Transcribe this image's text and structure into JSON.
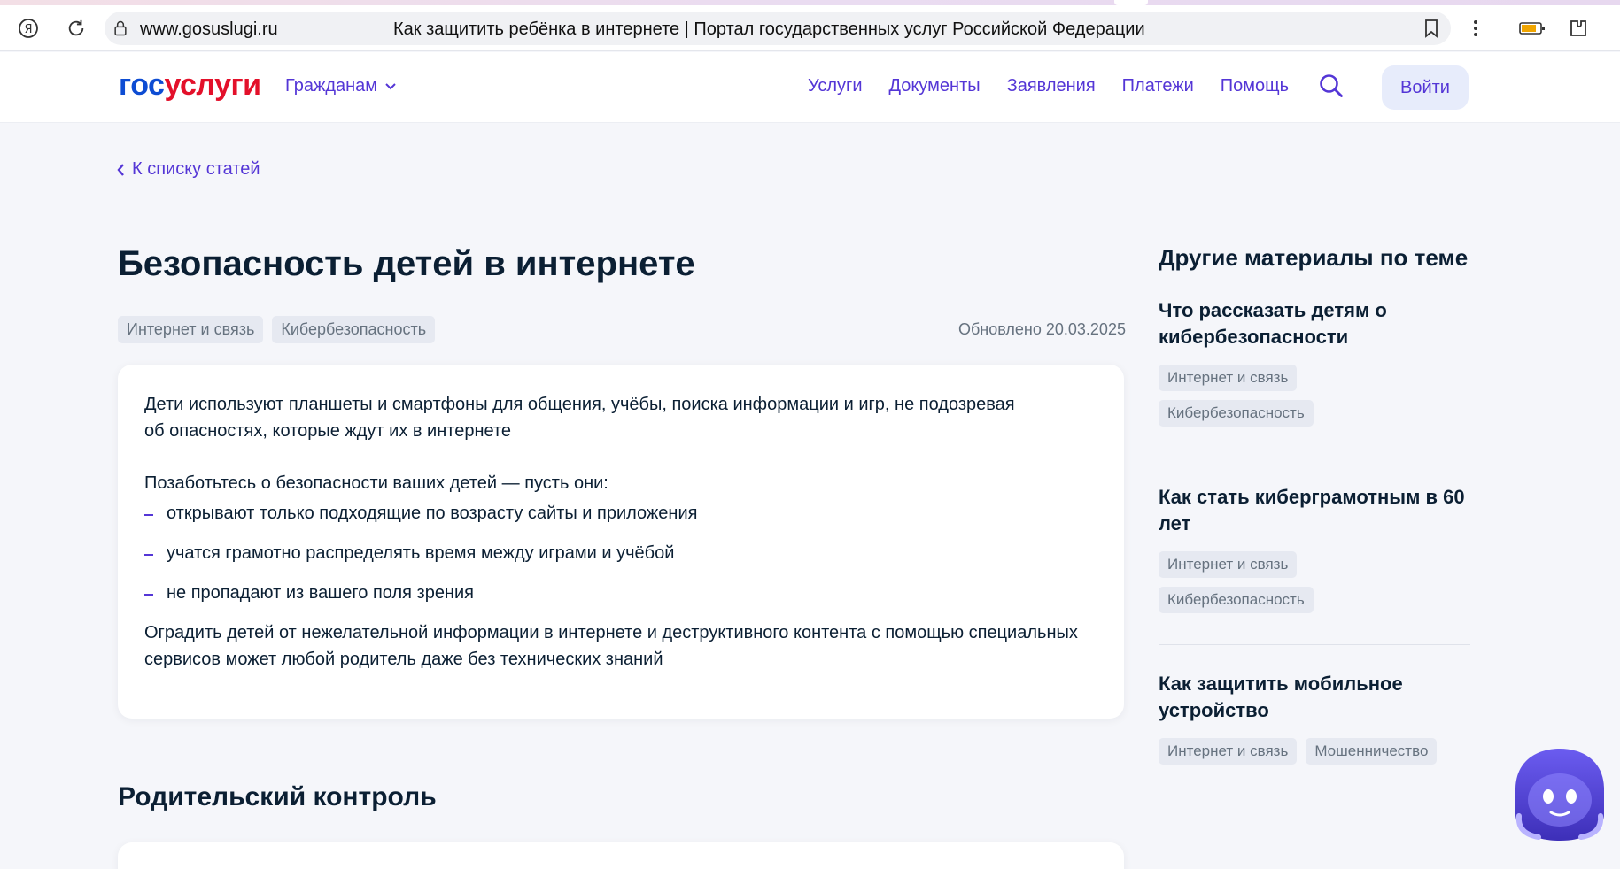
{
  "browser": {
    "domain": "www.gosuslugi.ru",
    "page_title": "Как защитить ребёнка в интернете | Портал государственных услуг Российской Федерации"
  },
  "header": {
    "logo_part1": "гос",
    "logo_part2": "услуги",
    "citizens_label": "Гражданам",
    "nav": [
      "Услуги",
      "Документы",
      "Заявления",
      "Платежи",
      "Помощь"
    ],
    "login_label": "Войти"
  },
  "article": {
    "back_label": "К списку статей",
    "title": "Безопасность детей в интернете",
    "tags": [
      "Интернет и связь",
      "Кибербезопасность"
    ],
    "updated": "Обновлено 20.03.2025",
    "intro": "Дети используют планшеты и смартфоны для общения, учёбы, поиска информации и игр, не подозревая об опасностях, которые ждут их в интернете",
    "lead": "Позаботьтесь о безопасности ваших детей — пусть они:",
    "bullets": [
      "открывают только подходящие по возрасту сайты и приложения",
      "учатся грамотно распределять время между играми и учёбой",
      "не пропадают из вашего поля зрения"
    ],
    "outro": "Оградить детей от нежелательной информации в интернете и деструктивного контента с помощью специальных сервисов может любой родитель даже без технических знаний",
    "section_title": "Родительский контроль"
  },
  "sidebar": {
    "title": "Другие материалы по теме",
    "items": [
      {
        "title": "Что рассказать детям о кибербезопасности",
        "tags": [
          "Интернет и связь",
          "Кибербезопасность"
        ]
      },
      {
        "title": "Как стать киберграмотным в 60 лет",
        "tags": [
          "Интернет и связь",
          "Кибербезопасность"
        ]
      },
      {
        "title": "Как защитить мобильное устройство",
        "tags": [
          "Интернет и связь",
          "Мошенничество"
        ]
      }
    ]
  },
  "colors": {
    "accent": "#5436d6",
    "logo_blue": "#0d4cd3",
    "logo_red": "#e3102a",
    "background": "#f5f6fa"
  }
}
